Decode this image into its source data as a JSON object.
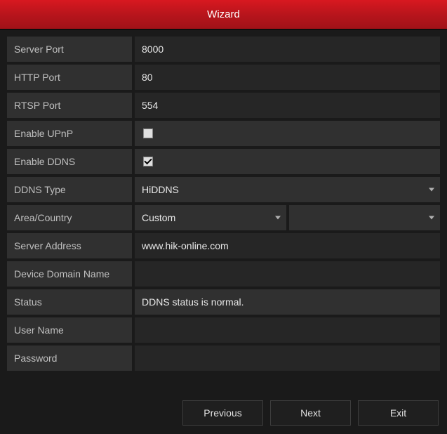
{
  "title": "Wizard",
  "fields": {
    "server_port": {
      "label": "Server Port",
      "value": "8000"
    },
    "http_port": {
      "label": "HTTP Port",
      "value": "80"
    },
    "rtsp_port": {
      "label": "RTSP Port",
      "value": "554"
    },
    "enable_upnp": {
      "label": "Enable UPnP",
      "checked": false
    },
    "enable_ddns": {
      "label": "Enable DDNS",
      "checked": true
    },
    "ddns_type": {
      "label": "DDNS Type",
      "value": "HiDDNS"
    },
    "area_country": {
      "label": "Area/Country",
      "value": "Custom",
      "value2": ""
    },
    "server_address": {
      "label": "Server Address",
      "value": "www.hik-online.com"
    },
    "device_domain_name": {
      "label": "Device Domain Name",
      "value": ""
    },
    "status": {
      "label": "Status",
      "value": "DDNS status is normal."
    },
    "user_name": {
      "label": "User Name",
      "value": ""
    },
    "password": {
      "label": "Password",
      "value": ""
    }
  },
  "buttons": {
    "previous": "Previous",
    "next": "Next",
    "exit": "Exit"
  }
}
